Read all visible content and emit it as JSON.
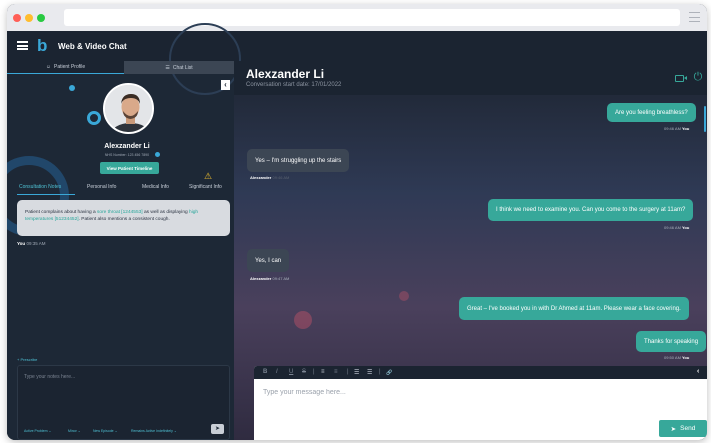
{
  "app": {
    "title": "Web & Video Chat",
    "logo_glyph": "b"
  },
  "left_panel": {
    "tabs": [
      {
        "label": "Patient Profile",
        "icon": "person-icon"
      },
      {
        "label": "Chat List",
        "icon": "list-icon"
      }
    ],
    "patient": {
      "name": "Alexzander Li",
      "nhs_number": "NHS Number: 123 456 7890",
      "timeline_button": "View Patient Timeline"
    },
    "sub_tabs": [
      "Consultation Notes",
      "Personal Info",
      "Medical Info",
      "Significant Info"
    ],
    "note": {
      "text_before": "Patient complains about having a ",
      "highlight_1": "sore throat [1244553]",
      "text_middle": " as well as displaying ",
      "highlight_2": "high temperatures [51234452]",
      "text_after": ". Patient also mentions a consistent cough.",
      "author": "You",
      "time": "09:35 AM"
    },
    "prescribe_label": "Prescribe",
    "notes_placeholder": "Type your notes here...",
    "dropdowns": [
      "Active Problem",
      "Minor",
      "New Episode",
      "Remains Active Indefinitely"
    ]
  },
  "conversation": {
    "name": "Alexzander Li",
    "start_date": "Conversation start date: 17/01/2022",
    "messages": [
      {
        "direction": "out",
        "text": "Are you feeling breathless?",
        "time": "09:46 AM",
        "author": "You"
      },
      {
        "direction": "in",
        "text": "Yes – I'm struggling up the stairs",
        "time": "09:46 AM",
        "author": "Alexzander"
      },
      {
        "direction": "out",
        "text": "I think we need to examine you. Can you come to the surgery at 11am?",
        "time": "09:46 AM",
        "author": "You"
      },
      {
        "direction": "in",
        "text": "Yes, I can",
        "time": "09:47 AM",
        "author": "Alexzander"
      },
      {
        "direction": "out",
        "text": "Great – I've booked you in with Dr Ahmed at 11am. Please wear a face covering.",
        "time": "",
        "author": ""
      },
      {
        "direction": "out",
        "text": "Thanks for speaking",
        "time": "09:50 AM",
        "author": "You"
      }
    ],
    "composer": {
      "placeholder": "Type your message here...",
      "send_label": "Send",
      "tools": [
        "B",
        "I",
        "U",
        "S",
        "|",
        "≡",
        "≡",
        "|",
        "☰",
        "☰",
        "|",
        "🔗"
      ]
    }
  },
  "colors": {
    "accent": "#37a89a",
    "header": "#1b2431",
    "panel": "#1d2836",
    "warning": "#f2c12e"
  }
}
